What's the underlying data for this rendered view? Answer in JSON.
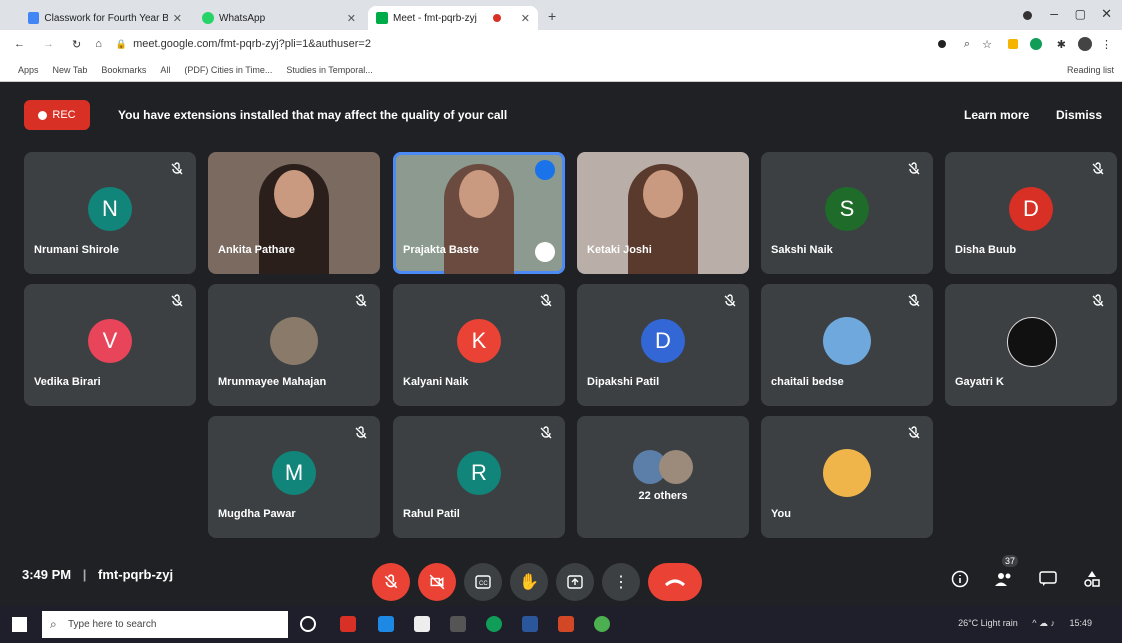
{
  "browser": {
    "tabs": [
      {
        "label": "Classwork for Fourth Year B.Arch",
        "color": "#4285f4"
      },
      {
        "label": "WhatsApp",
        "color": "#25d366"
      },
      {
        "label": "Meet - fmt-pqrb-zyj",
        "color": "#00ac47"
      }
    ],
    "url": "meet.google.com/fmt-pqrb-zyj?pli=1&authuser=2",
    "bookmarks": [
      "Apps",
      "New Tab",
      "Bookmarks",
      "All",
      "(PDF) Cities in Time...",
      "Studies in Temporal..."
    ],
    "reading_list": "Reading list"
  },
  "meet": {
    "rec_label": "REC",
    "banner_message": "You have extensions installed that may affect the quality of your call",
    "learn_more": "Learn more",
    "dismiss": "Dismiss",
    "participants": [
      {
        "name": "Nrumani Shirole",
        "initial": "N",
        "color": "#12857a"
      },
      {
        "name": "Ankita Pathare",
        "type": "video"
      },
      {
        "name": "Prajakta Baste",
        "type": "video"
      },
      {
        "name": "Ketaki Joshi",
        "type": "video"
      },
      {
        "name": "Sakshi Naik",
        "initial": "S",
        "color": "#1e6b2a"
      },
      {
        "name": "Disha Buub",
        "initial": "D",
        "color": "#d93025"
      },
      {
        "name": "Vedika Birari",
        "initial": "V",
        "color": "#e8445a"
      },
      {
        "name": "Mrunmayee Mahajan",
        "type": "photo"
      },
      {
        "name": "Kalyani Naik",
        "initial": "K",
        "color": "#ea4335"
      },
      {
        "name": "Dipakshi Patil",
        "initial": "D",
        "color": "#3367d6"
      },
      {
        "name": "chaitali bedse",
        "type": "photo"
      },
      {
        "name": "Gayatri K",
        "type": "photo"
      },
      {
        "name": "Mugdha Pawar",
        "initial": "M",
        "color": "#12857a"
      },
      {
        "name": "Rahul Patil",
        "initial": "R",
        "color": "#12857a"
      },
      {
        "name": "22 others",
        "type": "others"
      },
      {
        "name": "You",
        "type": "photo"
      }
    ],
    "time": "3:49 PM",
    "separator": "|",
    "meeting_code": "fmt-pqrb-zyj",
    "people_count": "37"
  },
  "taskbar": {
    "search_placeholder": "Type here to search",
    "weather": "26°C Light rain",
    "time": "15:49"
  }
}
